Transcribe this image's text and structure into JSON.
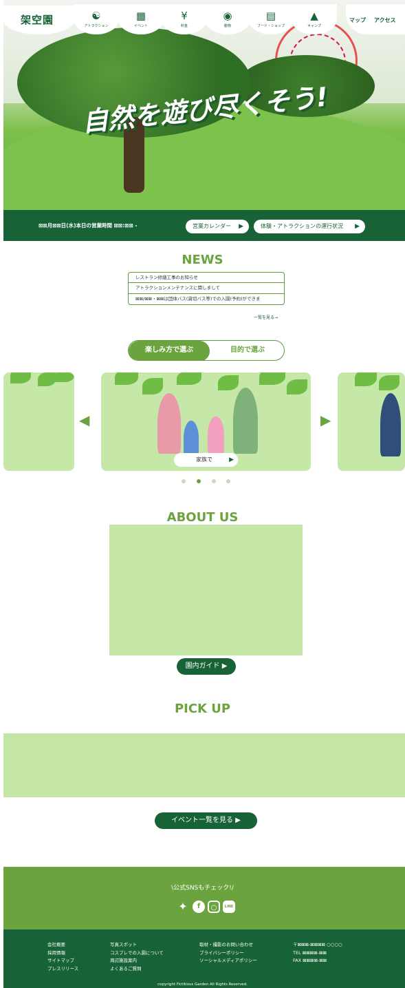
{
  "header": {
    "logo": "架空園",
    "nav": [
      {
        "label": "アトラクション",
        "icon": "roller-coaster-icon"
      },
      {
        "label": "イベント",
        "icon": "calendar-icon"
      },
      {
        "label": "料金",
        "icon": "yen-icon"
      },
      {
        "label": "動物",
        "icon": "animal-icon"
      },
      {
        "label": "フード・ショップ",
        "icon": "shop-icon"
      },
      {
        "label": "キャンプ",
        "icon": "tent-icon"
      }
    ],
    "map": "マップ",
    "access": "アクセス"
  },
  "hero": {
    "catch": "自然を遊び尽くそう!"
  },
  "hours": {
    "text": "⊠⊠月⊠⊠日(水)本日の営業時間 ⊠⊠:⊠⊠ -",
    "calendar_btn": "営業カレンダー",
    "status_btn": "体験・アトラクションの運行状況"
  },
  "news": {
    "title": "NEWS",
    "items": [
      "レストラン修繕工事のお知らせ",
      "アトラクションメンテナンスに関しまして",
      "⊠⊠/⊠⊠・⊠⊠は団体バス(貸切バス等)での入園(予約)ができま"
    ],
    "more": "一覧を見る→"
  },
  "tabs": {
    "active": "楽しみ方で選ぶ",
    "inactive": "目的で選ぶ"
  },
  "carousel": {
    "card_label": "家族で",
    "dots": 4,
    "active_dot": 1
  },
  "about": {
    "title": "ABOUT US",
    "guide_btn": "園内ガイド ▶"
  },
  "pickup": {
    "title": "PICK UP",
    "events_btn": "イベント一覧を見る ▶"
  },
  "sns": {
    "title": "\\公式SNSもチェック!/"
  },
  "footer": {
    "col1": [
      "会社概要",
      "採用情報",
      "サイトマップ",
      "プレスリリース"
    ],
    "col2": [
      "写真スポット",
      "コスプレでの入園について",
      "周辺施設案内",
      "よくあるご質問"
    ],
    "col3": [
      "取材・撮影のお問い合わせ",
      "プライバシーポリシー",
      "ソーシャルメディアポリシー"
    ],
    "col4": [
      "〒⊠⊠⊠-⊠⊠⊠⊠ ○○○○",
      "TEL ⊠⊠⊠⊠-⊠⊠",
      "FAX ⊠⊠⊠⊠-⊠⊠"
    ],
    "copyright": "copyright Fictitious Garden All Rights Reserved."
  },
  "colors": {
    "brand_green": "#176337",
    "accent_green": "#6ba33f",
    "light_green": "#c3e6a6"
  }
}
